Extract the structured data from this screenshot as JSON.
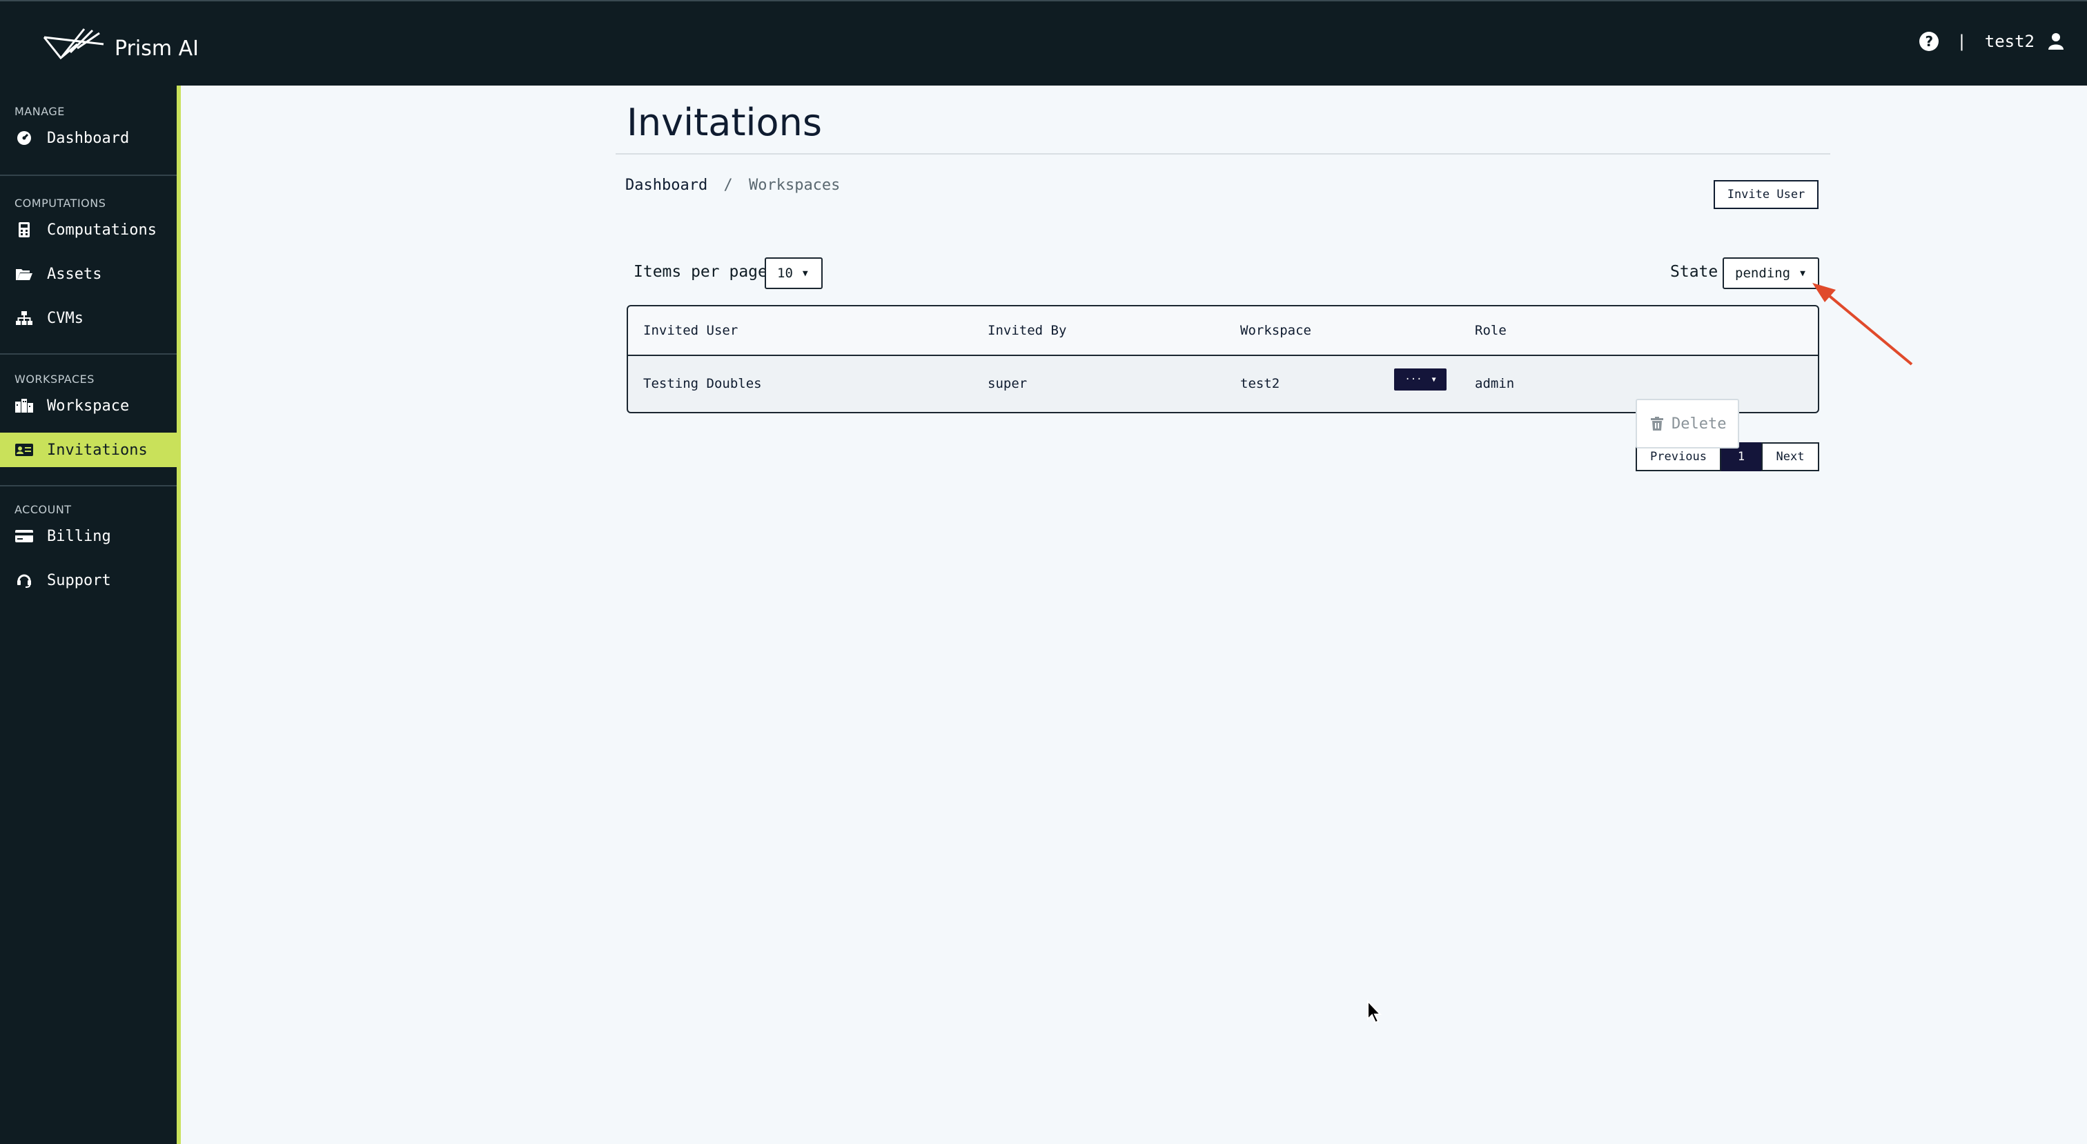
{
  "app": {
    "name": "Prism AI"
  },
  "header": {
    "help_icon": "question-circle-icon",
    "separator": "|",
    "username": "test2",
    "user_icon": "user-icon"
  },
  "sidebar": {
    "sections": [
      {
        "title": "MANAGE",
        "items": [
          {
            "label": "Dashboard",
            "icon": "gauge-icon"
          }
        ]
      },
      {
        "title": "COMPUTATIONS",
        "items": [
          {
            "label": "Computations",
            "icon": "calculator-icon"
          },
          {
            "label": "Assets",
            "icon": "folder-open-icon"
          },
          {
            "label": "CVMs",
            "icon": "sitemap-icon"
          }
        ]
      },
      {
        "title": "WORKSPACES",
        "items": [
          {
            "label": "Workspace",
            "icon": "building-icon"
          },
          {
            "label": "Invitations",
            "icon": "id-card-icon",
            "active": true
          }
        ]
      },
      {
        "title": "ACCOUNT",
        "items": [
          {
            "label": "Billing",
            "icon": "credit-card-icon"
          },
          {
            "label": "Support",
            "icon": "headset-icon"
          }
        ]
      }
    ]
  },
  "page": {
    "title": "Invitations",
    "breadcrumb": {
      "root": "Dashboard",
      "sep": "/",
      "current": "Workspaces"
    },
    "invite_button": "Invite User",
    "items_per_page_label": "Items per page",
    "items_per_page_value": "10",
    "state_label": "State",
    "state_value": "pending"
  },
  "table": {
    "columns": [
      "Invited User",
      "Invited By",
      "Workspace",
      "Role"
    ],
    "rows": [
      {
        "invited_user": "Testing Doubles",
        "invited_by": "super",
        "workspace": "test2",
        "role": "admin"
      }
    ],
    "action_button": "···",
    "dropdown_item": "Delete"
  },
  "pagination": {
    "previous": "Previous",
    "current": "1",
    "next": "Next"
  },
  "colors": {
    "accent": "#c9e15a",
    "dark": "#0f1c22",
    "navy": "#14153a",
    "arrow": "#e04a2b"
  }
}
